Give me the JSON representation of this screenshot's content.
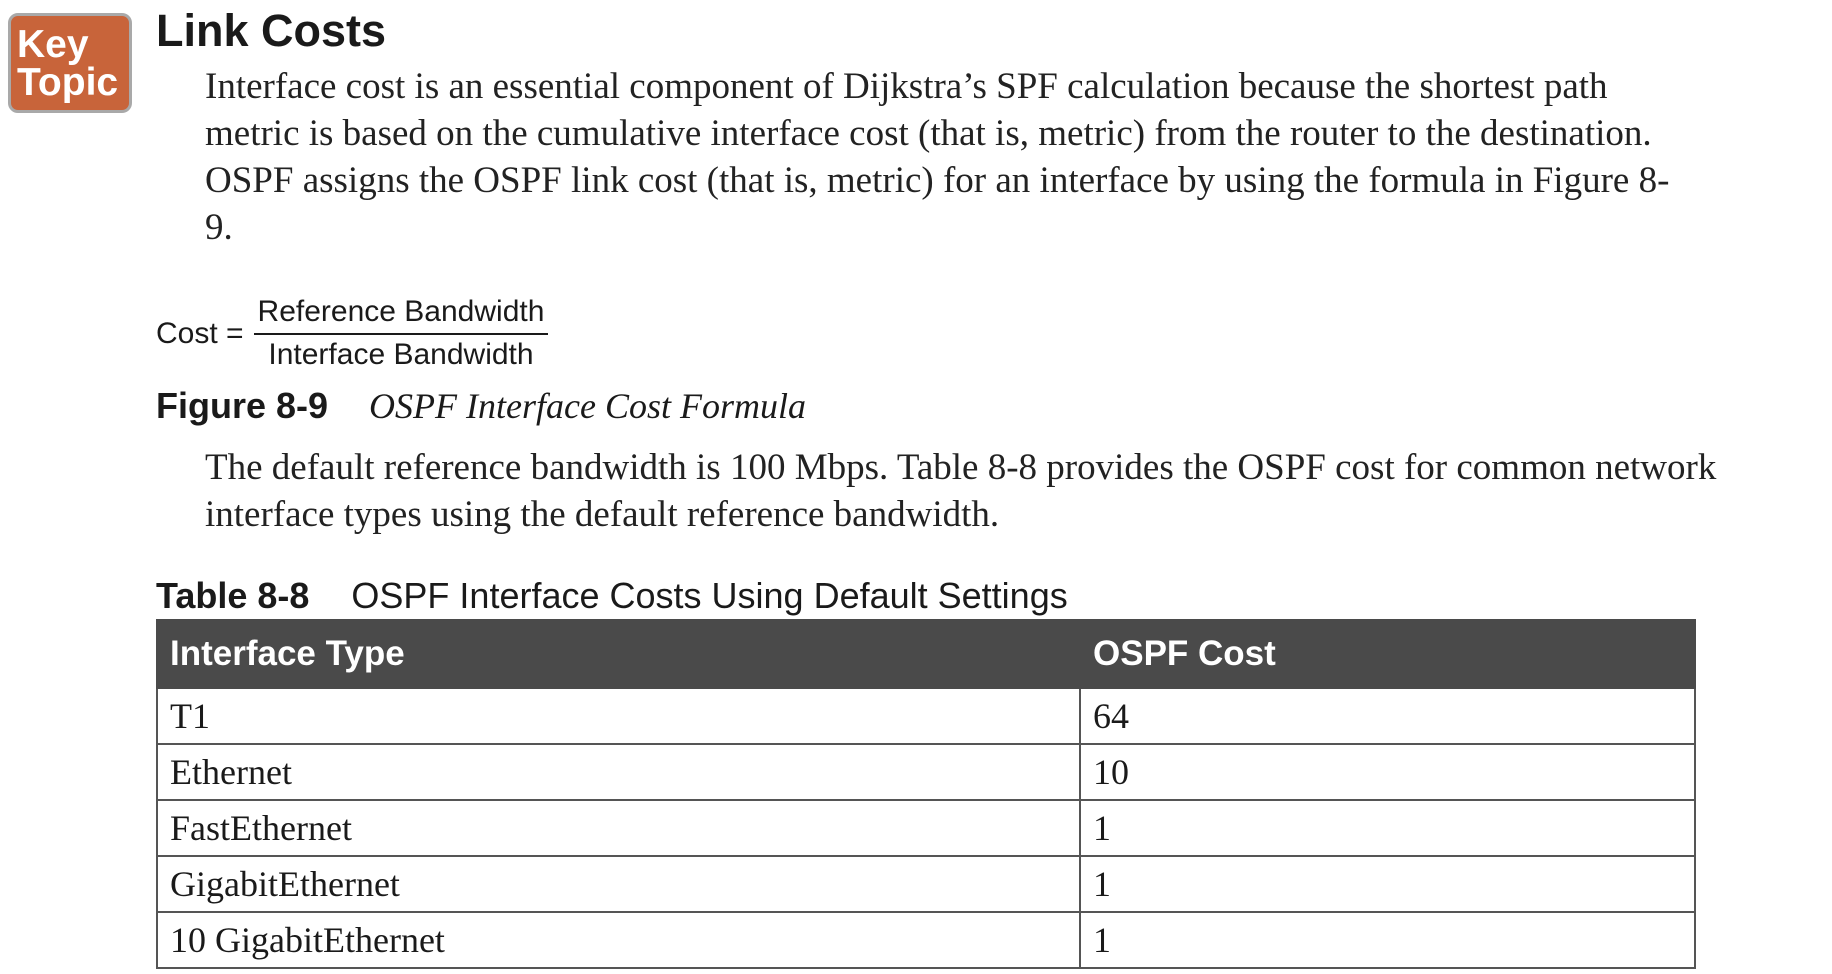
{
  "badge": {
    "line1": "Key",
    "line2": "Topic"
  },
  "heading": "Link Costs",
  "paragraph1": "Interface cost is an essential component of Dijkstra’s SPF calculation because the shortest path metric is based on the cumulative interface cost (that is, metric) from the router to the destination. OSPF assigns the OSPF link cost (that is, metric) for an interface by using the formula in Figure 8-9.",
  "formula": {
    "lhs": "Cost =",
    "numerator": "Reference Bandwidth",
    "denominator": "Interface Bandwidth"
  },
  "figure": {
    "number": "Figure 8-9",
    "title": "OSPF Interface Cost Formula"
  },
  "paragraph2": "The default reference bandwidth is 100 Mbps. Table 8-8 provides the OSPF cost for common network interface types using the default reference bandwidth.",
  "table": {
    "number": "Table 8-8",
    "title": "OSPF Interface Costs Using Default Settings",
    "headers": [
      "Interface Type",
      "OSPF Cost"
    ],
    "rows": [
      [
        "T1",
        "64"
      ],
      [
        "Ethernet",
        "10"
      ],
      [
        "FastEthernet",
        "1"
      ],
      [
        "GigabitEthernet",
        "1"
      ],
      [
        "10 GigabitEthernet",
        "1"
      ]
    ]
  },
  "colors": {
    "badge_bg": "#c8643a",
    "table_header_bg": "#4a4a4a"
  }
}
